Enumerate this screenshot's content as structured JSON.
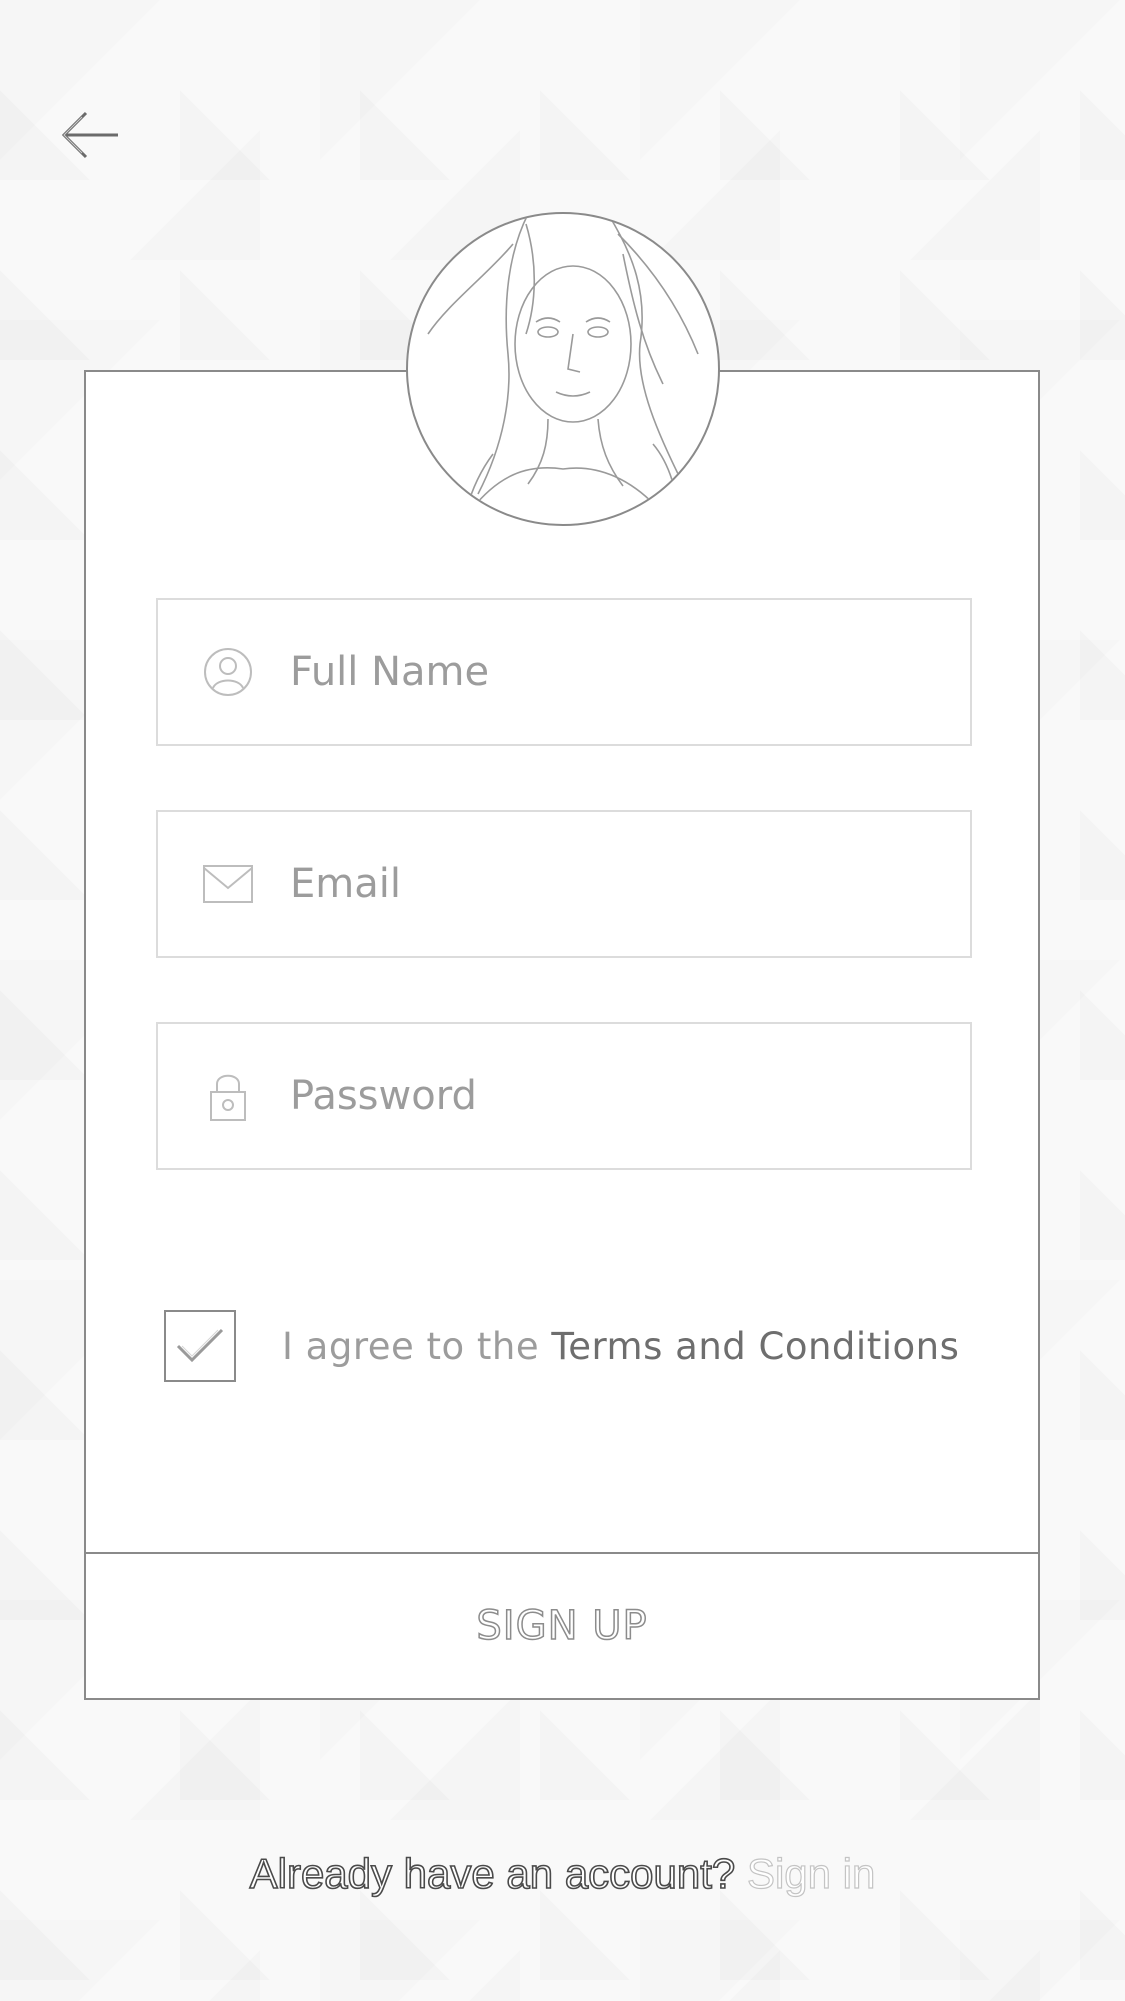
{
  "nav": {
    "back_icon": "arrow-left-icon"
  },
  "profile": {
    "avatar_icon": "portrait-avatar"
  },
  "form": {
    "full_name": {
      "placeholder": "Full Name",
      "value": "",
      "icon": "user-icon"
    },
    "email": {
      "placeholder": "Email",
      "value": "",
      "icon": "mail-icon"
    },
    "password": {
      "placeholder": "Password",
      "value": "",
      "icon": "lock-icon"
    }
  },
  "terms": {
    "checked": true,
    "prefix": "I agree to the ",
    "link": "Terms and Conditions"
  },
  "signup_button": "SIGN UP",
  "footer": {
    "prompt": "Already have an account? ",
    "link": "Sign in"
  }
}
